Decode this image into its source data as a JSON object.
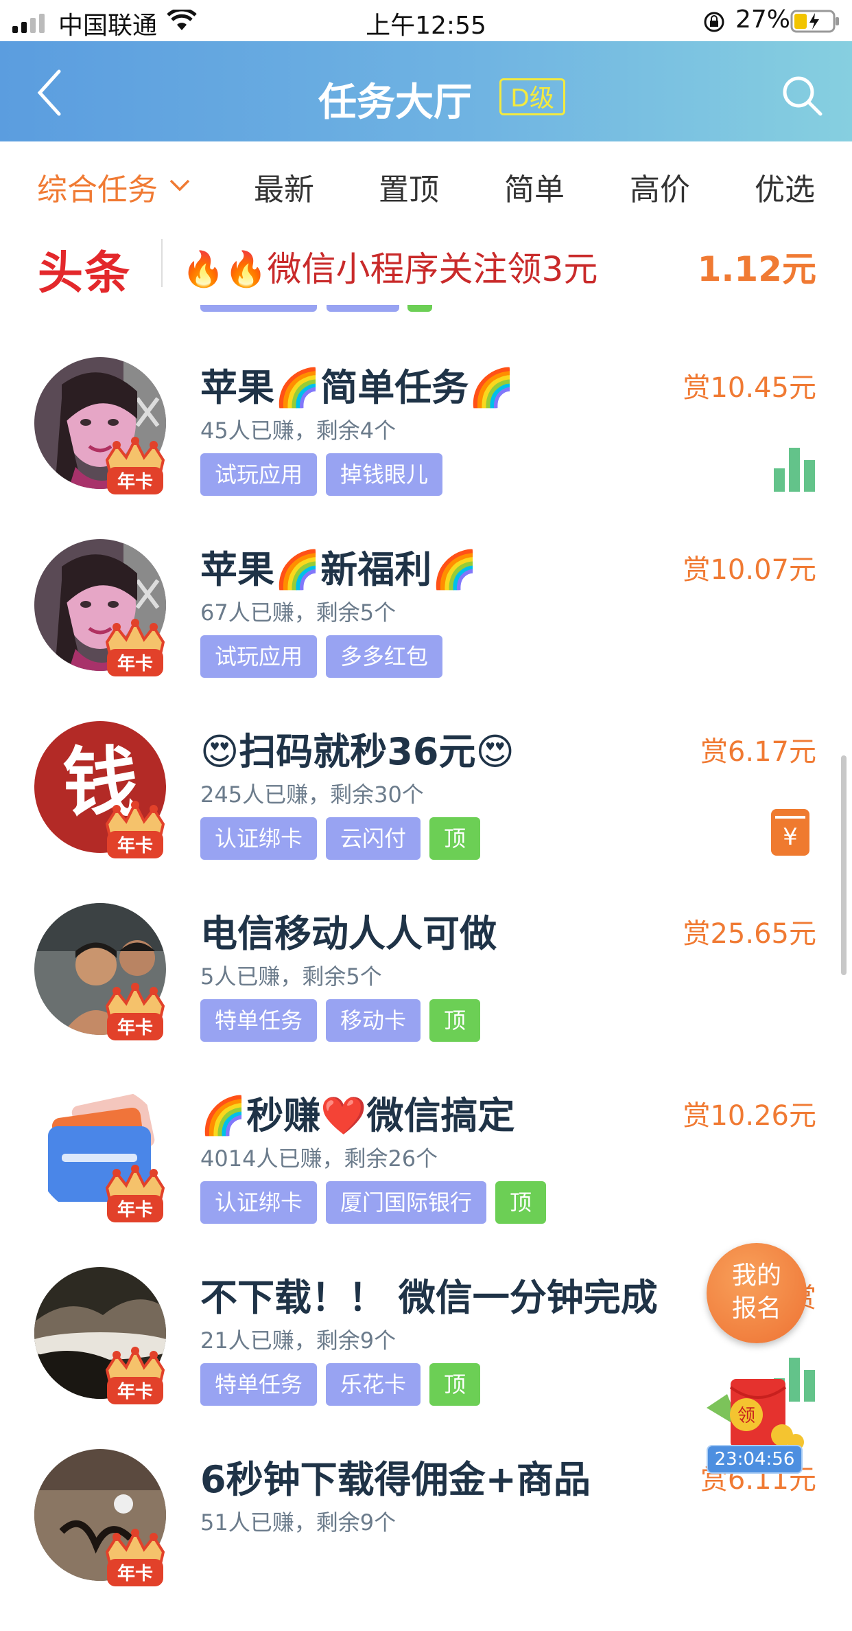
{
  "status_bar": {
    "carrier": "中国联通",
    "time": "上午12:55",
    "battery": "27%"
  },
  "header": {
    "title": "任务大厅",
    "level": "D级"
  },
  "tabs": [
    {
      "label": "综合任务"
    },
    {
      "label": "最新"
    },
    {
      "label": "置顶"
    },
    {
      "label": "简单"
    },
    {
      "label": "高价"
    },
    {
      "label": "优选"
    }
  ],
  "headline": {
    "logo": "头条",
    "text": "🔥🔥微信小程序关注领3元",
    "price": "1.12元"
  },
  "tasks": [
    {
      "title": "苹果🌈简单任务🌈",
      "meta": "45人已赚，剩余4个",
      "reward": "赏10.45元",
      "tags": [
        "试玩应用",
        "掉钱眼儿"
      ],
      "pinned": false,
      "avatar": "woman-photo",
      "side_icon": "bar-chart-icon"
    },
    {
      "title": "苹果🌈新福利🌈",
      "meta": "67人已赚，剩余5个",
      "reward": "赏10.07元",
      "tags": [
        "试玩应用",
        "多多红包"
      ],
      "pinned": false,
      "avatar": "woman-photo",
      "side_icon": ""
    },
    {
      "title": "😍扫码就秒36元😍",
      "meta": "245人已赚，剩余30个",
      "reward": "赏6.17元",
      "tags": [
        "认证绑卡",
        "云闪付"
      ],
      "pinned": true,
      "avatar": "qian-character",
      "avatar_text": "钱",
      "side_icon": "yuan-icon"
    },
    {
      "title": "电信移动人人可做",
      "meta": "5人已赚，剩余5个",
      "reward": "赏25.65元",
      "tags": [
        "特单任务",
        "移动卡"
      ],
      "pinned": true,
      "avatar": "men-photo",
      "side_icon": ""
    },
    {
      "title": "🌈秒赚❤️微信搞定",
      "meta": "4014人已赚，剩余26个",
      "reward": "赏10.26元",
      "tags": [
        "认证绑卡",
        "厦门国际银行"
      ],
      "pinned": true,
      "avatar": "bank-card-icon",
      "side_icon": ""
    },
    {
      "title": "不下载！！ 微信一分钟完成",
      "meta": "21人已赚，剩余9个",
      "reward": "赏",
      "tags": [
        "特单任务",
        "乐花卡"
      ],
      "pinned": true,
      "avatar": "landscape-photo",
      "side_icon": "bar-chart-icon"
    },
    {
      "title": "6秒钟下载得佣金+商品",
      "meta": "51人已赚，剩余9个",
      "reward": "赏6.11元",
      "tags": [],
      "pinned": false,
      "avatar": "calligraphy-photo",
      "side_icon": ""
    }
  ],
  "labels": {
    "top_tag": "顶",
    "crown_text": "年卡"
  },
  "floating": {
    "signup_line1": "我的",
    "signup_line2": "报名",
    "redpack_text": "领",
    "timer": "23:04:56"
  },
  "colors": {
    "accent": "#f07a33",
    "tag_bg": "#98a3f2",
    "pin_bg": "#6ccf55",
    "header_start": "#5b9ddf",
    "header_end": "#86cfe0"
  }
}
